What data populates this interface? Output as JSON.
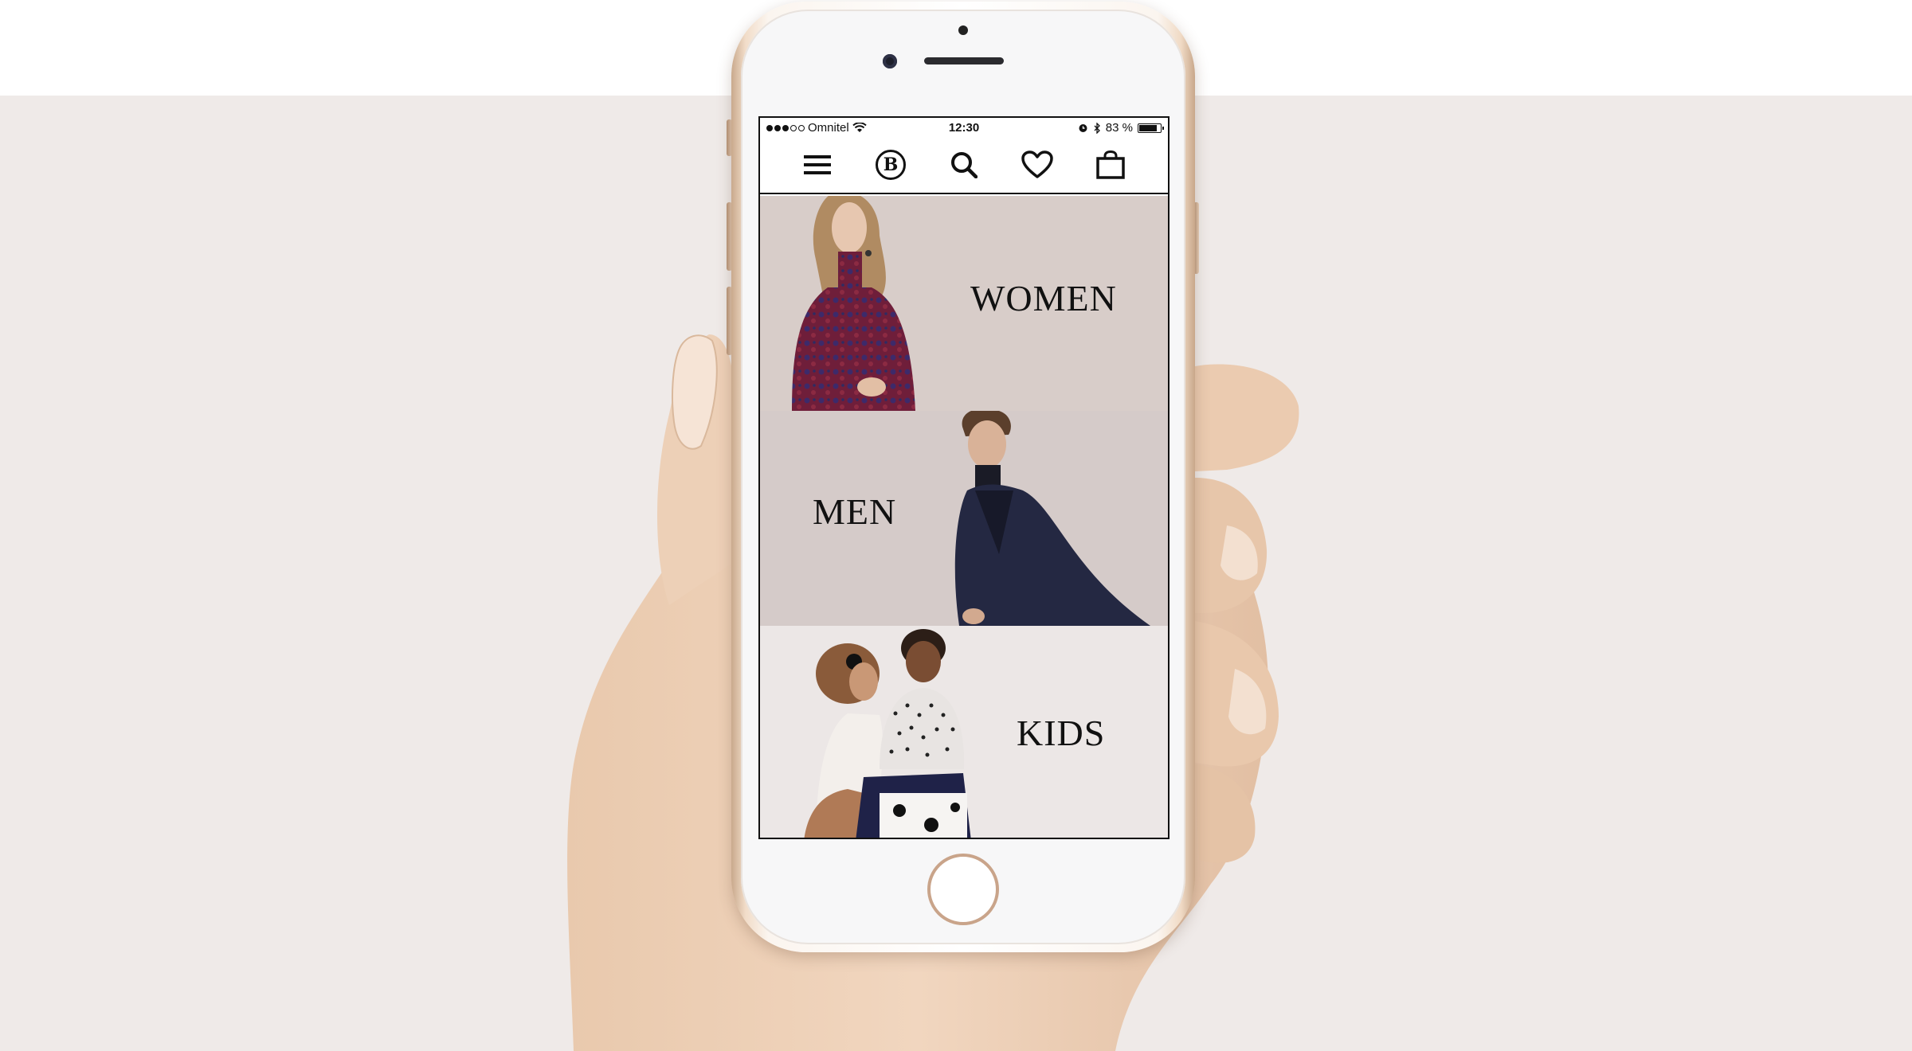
{
  "statusbar": {
    "carrier": "Omnitel",
    "time": "12:30",
    "battery": "83 %",
    "battery_level": 0.83
  },
  "navbar": {
    "logo": "B",
    "icons": [
      "menu-icon",
      "logo-icon",
      "search-icon",
      "heart-icon",
      "bag-icon"
    ]
  },
  "categories": [
    {
      "label": "WOMEN",
      "bg": "#d8cdc9"
    },
    {
      "label": "MEN",
      "bg": "#d5cbc9"
    },
    {
      "label": "KIDS",
      "bg": "#ece7e6"
    }
  ],
  "colors": {
    "page_bg": "#efeae8",
    "phone_gold": "#c9a48a"
  }
}
